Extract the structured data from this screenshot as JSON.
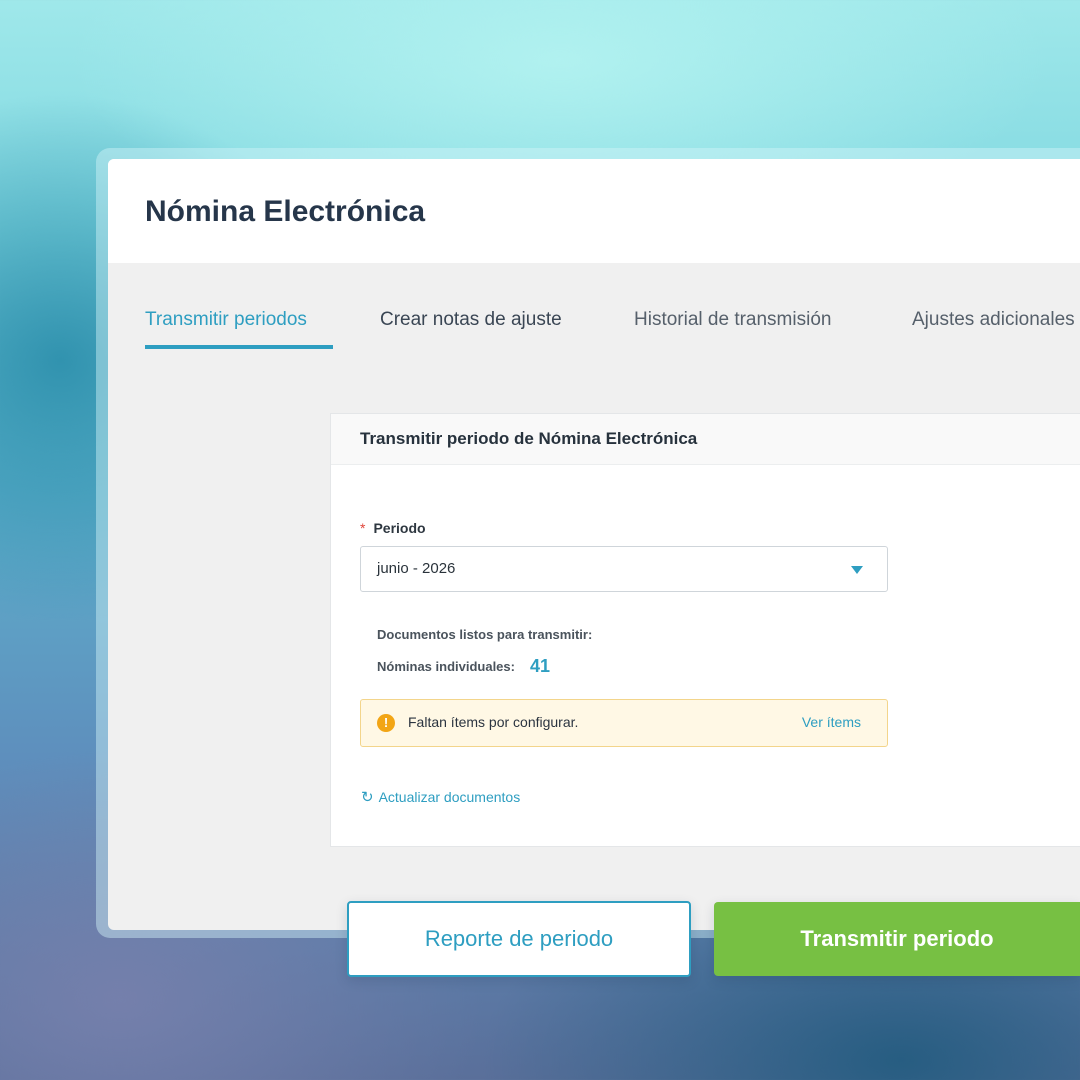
{
  "header": {
    "title": "Nómina Electrónica"
  },
  "tabs": [
    {
      "label": "Transmitir periodos",
      "active": true
    },
    {
      "label": "Crear notas de ajuste",
      "active": false
    },
    {
      "label": "Historial de transmisión",
      "active": false
    },
    {
      "label": "Ajustes adicionales",
      "active": false
    }
  ],
  "card": {
    "title": "Transmitir periodo de Nómina Electrónica",
    "period_field": {
      "required_mark": "*",
      "label": "Periodo",
      "value": "junio - 2026"
    },
    "documents_label": "Documentos listos para transmitir:",
    "individual_label": "Nóminas individuales:",
    "individual_count": "41",
    "alert": {
      "icon": "warning-icon",
      "text": "Faltan ítems por configurar.",
      "link": "Ver ítems"
    },
    "refresh": {
      "icon": "refresh-icon",
      "label": "Actualizar documentos"
    }
  },
  "actions": {
    "report_label": "Reporte de periodo",
    "transmit_label": "Transmitir periodo"
  },
  "colors": {
    "accent": "#2e9ec1",
    "primary_button": "#77c043",
    "warning": "#f2a515",
    "title": "#26364a"
  }
}
